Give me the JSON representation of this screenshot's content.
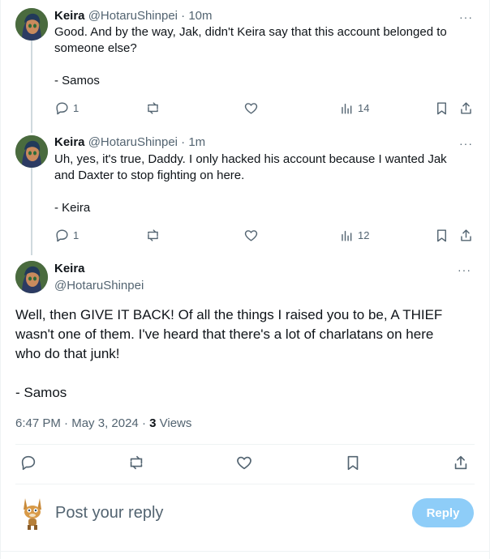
{
  "replies": [
    {
      "name": "Keira",
      "handle": "@HotaruShinpei",
      "separator": "·",
      "time": "10m",
      "text_lines": [
        "Good. And by the way, Jak, didn't Keira say that this account belonged to",
        "someone else?",
        "",
        "- Samos"
      ],
      "reply_count": "1",
      "views": "14"
    },
    {
      "name": "Keira",
      "handle": "@HotaruShinpei",
      "separator": "·",
      "time": "1m",
      "text_lines": [
        "Uh, yes, it's true, Daddy. I only hacked his account because I wanted Jak",
        "and Daxter to stop fighting on here.",
        "",
        "- Keira"
      ],
      "reply_count": "1",
      "views": "12"
    }
  ],
  "main_post": {
    "name": "Keira",
    "handle": "@HotaruShinpei",
    "text_lines": [
      "Well, then GIVE IT BACK! Of all the things I raised you to be, A THIEF",
      "wasn't one of them. I've heard that there's a lot of charlatans on here",
      "who do that junk!",
      "",
      "- Samos"
    ],
    "time": "6:47 PM",
    "date": "May 3, 2024",
    "views_count": "3",
    "views_label": "Views"
  },
  "more_label": "···",
  "composer": {
    "placeholder": "Post your reply",
    "button_label": "Reply"
  },
  "colors": {
    "text": "#0f1419",
    "muted": "#536471",
    "reply_button": "#8ecdf8",
    "thread_line": "#cfd9de"
  },
  "icons": [
    "reply-icon",
    "repost-icon",
    "like-icon",
    "views-icon",
    "bookmark-icon",
    "share-icon",
    "more-icon"
  ]
}
